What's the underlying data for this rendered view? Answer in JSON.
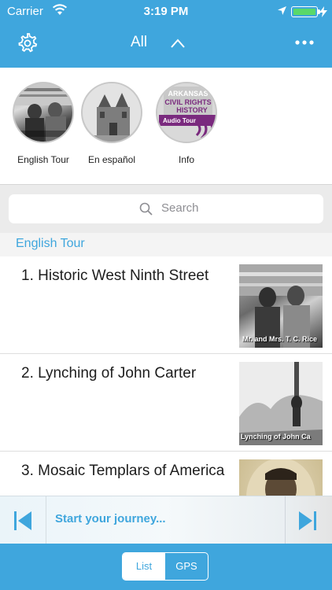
{
  "status_bar": {
    "carrier": "Carrier",
    "time": "3:19 PM",
    "icons": [
      "wifi-icon",
      "location-arrow-icon",
      "battery-icon",
      "charging-bolt-icon"
    ]
  },
  "nav": {
    "title": "All",
    "icons": [
      "gear-icon",
      "chevron-up-icon",
      "more-icon"
    ]
  },
  "tours": [
    {
      "label": "English Tour"
    },
    {
      "label": "En español"
    },
    {
      "label": "Info"
    }
  ],
  "info_logo": {
    "line1": "ARKANSAS",
    "line2": "CIVIL RIGHTS",
    "line3": "HISTORY",
    "line4": "Audio Tour"
  },
  "search": {
    "placeholder": "Search"
  },
  "section": {
    "title": "English Tour"
  },
  "list": [
    {
      "title": "1. Historic West Ninth Street",
      "caption": "Mr. and Mrs. T. C. Rice"
    },
    {
      "title": "2. Lynching of John Carter",
      "caption": "Lynching of John Ca"
    },
    {
      "title": "3. Mosaic Templars of America",
      "caption": ""
    }
  ],
  "player": {
    "label": "Start your journey..."
  },
  "toolbar": {
    "segments": [
      {
        "label": "List",
        "selected": true
      },
      {
        "label": "GPS",
        "selected": false
      }
    ]
  },
  "colors": {
    "brand": "#3fa6dd",
    "battery": "#59d86a"
  }
}
